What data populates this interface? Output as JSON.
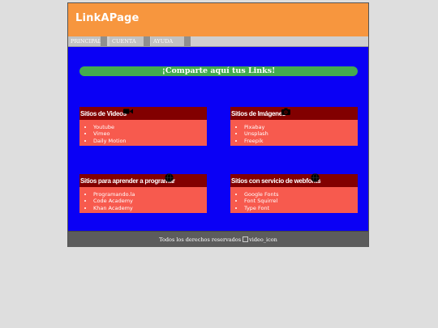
{
  "header": {
    "logo": "LinkAPage"
  },
  "nav": {
    "items": [
      "PRINCIPAL",
      "CUENTA",
      "AYUDA"
    ]
  },
  "banner": {
    "text": "¡Comparte aquí tus Links!"
  },
  "cards": [
    {
      "title": "Sitios de Videos",
      "icon": "video-camera-icon",
      "links": [
        "Youtube",
        "Vimeo",
        "Daily Motion"
      ]
    },
    {
      "title": "Sitios de Imágenes",
      "icon": "camera-icon",
      "links": [
        "Pixabay",
        "Unsplash",
        "Freepik"
      ]
    },
    {
      "title": "Sitios para aprender a programar",
      "icon": "globe-icon",
      "links": [
        "Programando.la",
        "Code Academy",
        "Khan Academy"
      ]
    },
    {
      "title": "Sitios con servicio de webfonts",
      "icon": "globe-icon",
      "links": [
        "Google Fonts",
        "Font Squirrel",
        "Type Font"
      ]
    }
  ],
  "footer": {
    "text": "Todos los derechos reservados",
    "img_alt": "video_icon"
  }
}
